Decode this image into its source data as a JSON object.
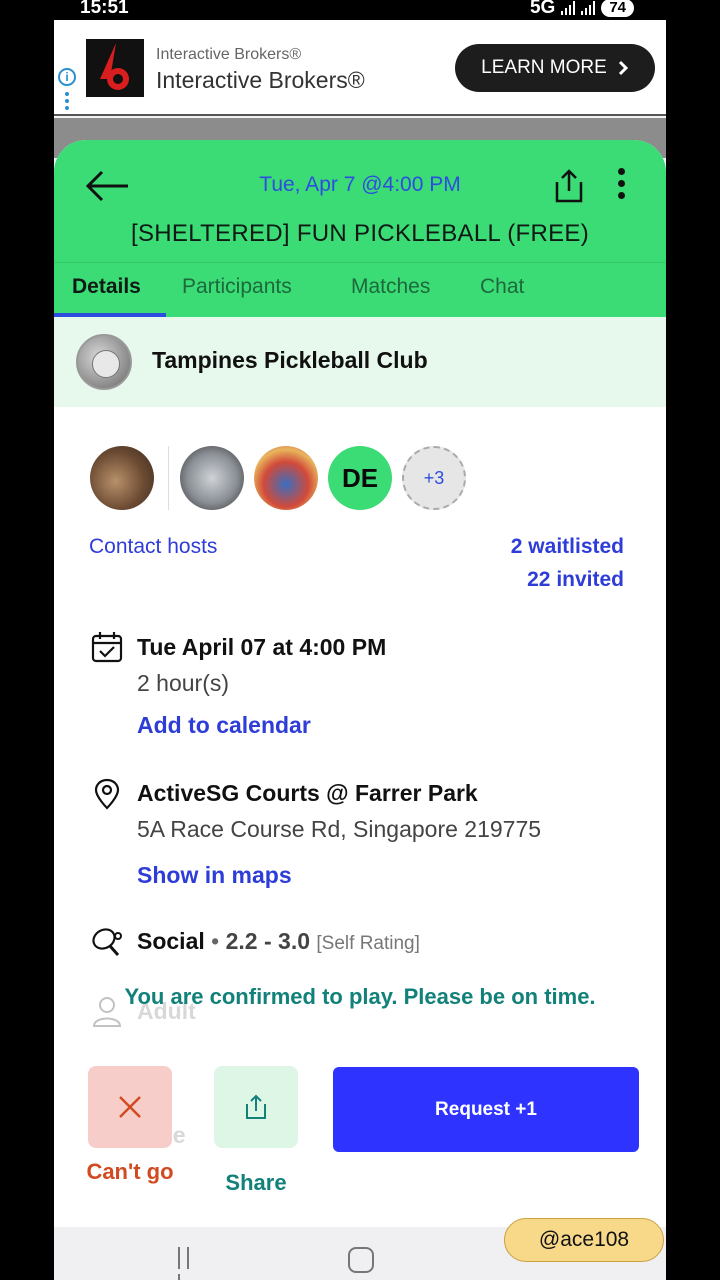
{
  "status_bar": {
    "time": "15:51",
    "network": "5G",
    "battery": "74"
  },
  "ad": {
    "brand_small": "Interactive Brokers®",
    "brand_big": "Interactive Brokers®",
    "cta": "LEARN MORE",
    "info_icon": "info-icon"
  },
  "header": {
    "date": "Tue, Apr 7 @4:00 PM",
    "title": "[SHELTERED] FUN PICKLEBALL (FREE)",
    "tabs": [
      {
        "label": "Details",
        "active": true
      },
      {
        "label": "Participants",
        "active": false
      },
      {
        "label": "Matches",
        "active": false
      },
      {
        "label": "Chat",
        "active": false
      }
    ],
    "accent_color": "#3bdb75",
    "link_color": "#2e4de0"
  },
  "club": {
    "name": "Tampines Pickleball Club"
  },
  "participants": {
    "avatar4_initials": "DE",
    "more_count": "+3",
    "contact_hosts": "Contact hosts",
    "waitlisted": "2 waitlisted",
    "invited": "22 invited"
  },
  "schedule": {
    "datetime": "Tue April 07 at 4:00 PM",
    "duration": "2 hour(s)",
    "add_calendar": "Add to calendar"
  },
  "location": {
    "venue": "ActiveSG Courts @ Farrer Park",
    "address": "5A Race Course Rd, Singapore 219775",
    "show_maps": "Show in maps"
  },
  "level": {
    "type": "Social",
    "separator": "•",
    "range": "2.2 - 3.0",
    "rating_tag": "[Self Rating]"
  },
  "faded_rows": {
    "age": "Adult",
    "fee": "Free"
  },
  "confirmation": "You are confirmed to play. Please be on time.",
  "actions": {
    "cant_go": "Can't go",
    "share": "Share",
    "request": "Request +1"
  },
  "watermark": "@ace108"
}
